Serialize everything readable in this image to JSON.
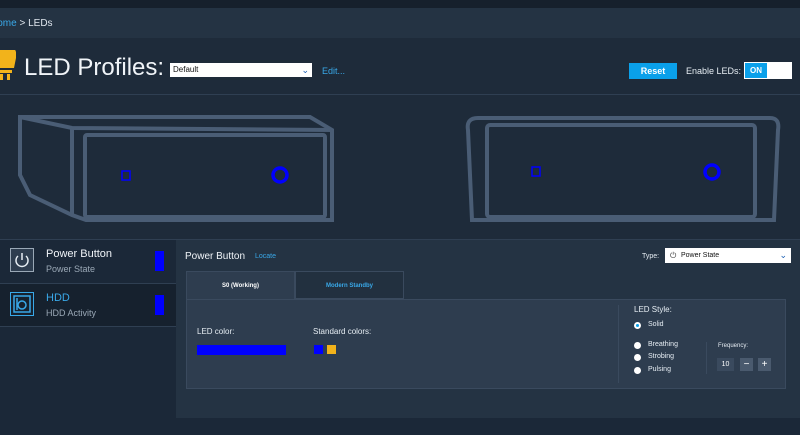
{
  "breadcrumb": {
    "home": "Home",
    "separator": " > ",
    "current": "LEDs"
  },
  "header": {
    "title": "LED Profiles:",
    "profile_value": "Default",
    "edit_label": "Edit...",
    "reset_label": "Reset",
    "enable_label": "Enable LEDs:",
    "toggle_state": "ON"
  },
  "devices": [
    {
      "name": "Power Button",
      "sub": "Power State",
      "icon": "power-icon",
      "color": "#0000ff"
    },
    {
      "name": "HDD",
      "sub": "HDD Activity",
      "icon": "hdd-icon",
      "color": "#0000ff"
    }
  ],
  "panel": {
    "title": "Power Button",
    "locate_label": "Locate",
    "type_label": "Type:",
    "type_value": "Power State",
    "tabs": [
      {
        "label": "S0 (Working)"
      },
      {
        "label": "Modern Standby"
      }
    ],
    "led_color_label": "LED color:",
    "standard_colors_label": "Standard colors:",
    "led_color": "#0000ff",
    "standard_colors": [
      "#0000ff",
      "#f2b31b"
    ],
    "led_style_label": "LED Style:",
    "styles": [
      {
        "label": "Solid",
        "selected": true
      },
      {
        "label": "Breathing",
        "selected": false
      },
      {
        "label": "Strobing",
        "selected": false
      },
      {
        "label": "Pulsing",
        "selected": false
      }
    ],
    "frequency_label": "Frequency:",
    "frequency_value": "10",
    "minus": "−",
    "plus": "+"
  },
  "colors": {
    "accent": "#0aa0ea",
    "background": "#1e2b3a",
    "bulb": "#f2b31b"
  }
}
